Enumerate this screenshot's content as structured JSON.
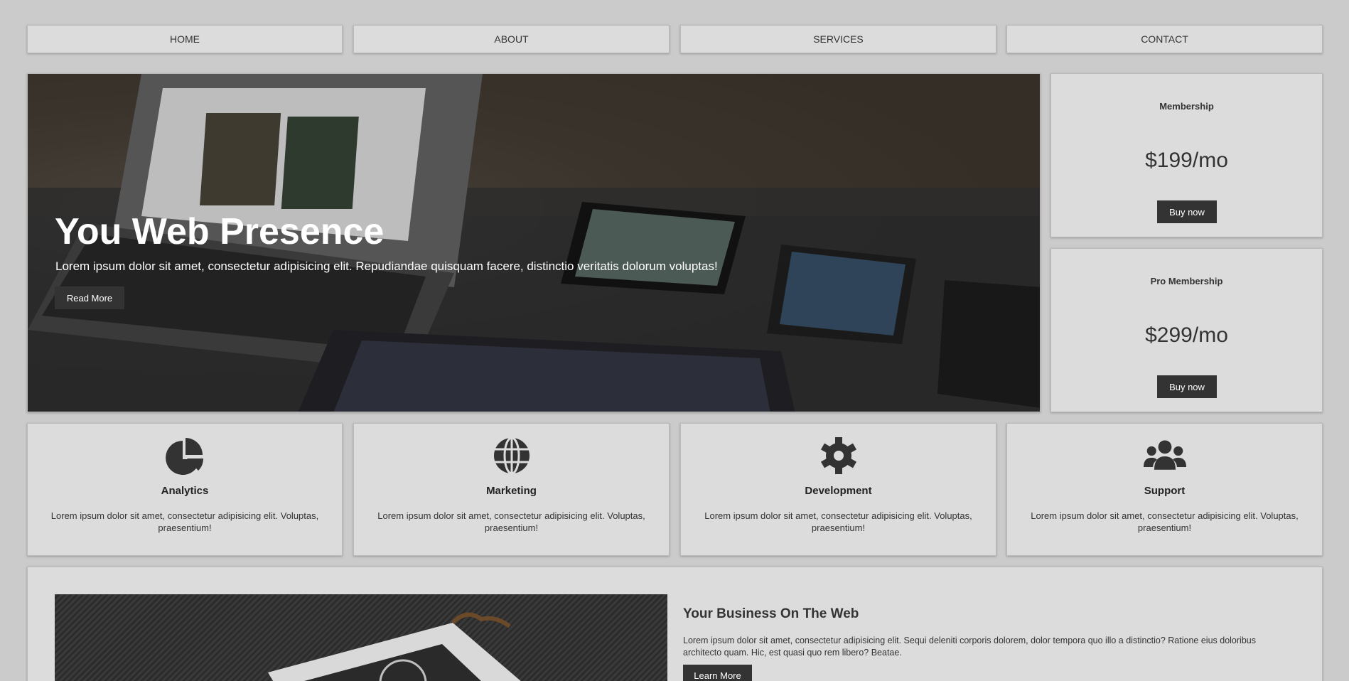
{
  "nav": {
    "items": [
      {
        "label": "HOME"
      },
      {
        "label": "ABOUT"
      },
      {
        "label": "SERVICES"
      },
      {
        "label": "CONTACT"
      }
    ]
  },
  "hero": {
    "title": "You Web Presence",
    "text": "Lorem ipsum dolor sit amet, consectetur adipisicing elit. Repudiandae quisquam facere, distinctio veritatis dolorum voluptas!",
    "button_label": "Read More"
  },
  "pricing": [
    {
      "name": "Membership",
      "price": "$199/mo",
      "button_label": "Buy now"
    },
    {
      "name": "Pro Membership",
      "price": "$299/mo",
      "button_label": "Buy now"
    }
  ],
  "features": [
    {
      "icon": "pie-chart-icon",
      "title": "Analytics",
      "text": "Lorem ipsum dolor sit amet, consectetur adipisicing elit. Voluptas, praesentium!"
    },
    {
      "icon": "globe-icon",
      "title": "Marketing",
      "text": "Lorem ipsum dolor sit amet, consectetur adipisicing elit. Voluptas, praesentium!"
    },
    {
      "icon": "gear-icon",
      "title": "Development",
      "text": "Lorem ipsum dolor sit amet, consectetur adipisicing elit. Voluptas, praesentium!"
    },
    {
      "icon": "users-icon",
      "title": "Support",
      "text": "Lorem ipsum dolor sit amet, consectetur adipisicing elit. Voluptas, praesentium!"
    }
  ],
  "business": {
    "title": "Your Business On The Web",
    "text": "Lorem ipsum dolor sit amet, consectetur adipisicing elit. Sequi deleniti corporis dolorem, dolor tempora quo illo a distinctio? Ratione eius doloribus architecto quam. Hic, est quasi quo rem libero? Beatae.",
    "button_label": "Learn More"
  },
  "colors": {
    "background": "#cbcbcb",
    "card": "#dcdcdc",
    "button": "#333333",
    "text": "#333333"
  }
}
